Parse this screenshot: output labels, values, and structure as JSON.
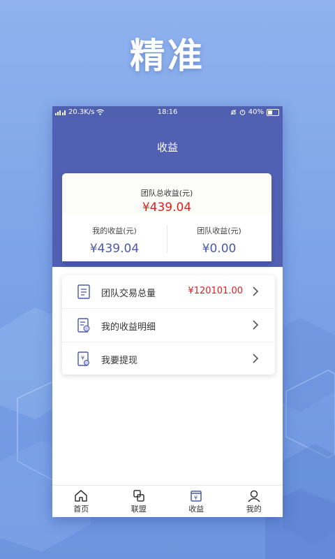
{
  "headline": "精准",
  "status_bar": {
    "speed": "20.3K/s",
    "time": "18:16",
    "battery": "40%"
  },
  "header": {
    "title": "收益"
  },
  "summary": {
    "total_label": "团队总收益(元)",
    "total_value": "¥439.04",
    "my_label": "我的收益(元)",
    "my_value": "¥439.04",
    "team_label": "团队收益(元)",
    "team_value": "¥0.00"
  },
  "menu": {
    "items": [
      {
        "label": "团队交易总量",
        "value": "¥120101.00",
        "icon": "document-icon"
      },
      {
        "label": "我的收益明细",
        "value": "",
        "icon": "earnings-detail-icon"
      },
      {
        "label": "我要提现",
        "value": "",
        "icon": "withdraw-icon"
      }
    ]
  },
  "tabbar": {
    "tabs": [
      {
        "label": "首页",
        "icon": "home-icon"
      },
      {
        "label": "联盟",
        "icon": "alliance-icon"
      },
      {
        "label": "收益",
        "icon": "earnings-icon"
      },
      {
        "label": "我的",
        "icon": "user-icon"
      }
    ]
  },
  "colors": {
    "primary": "#5160b2",
    "accent_red": "#e02020",
    "value_blue": "#4a59a8",
    "background": "#7aa1e6"
  }
}
